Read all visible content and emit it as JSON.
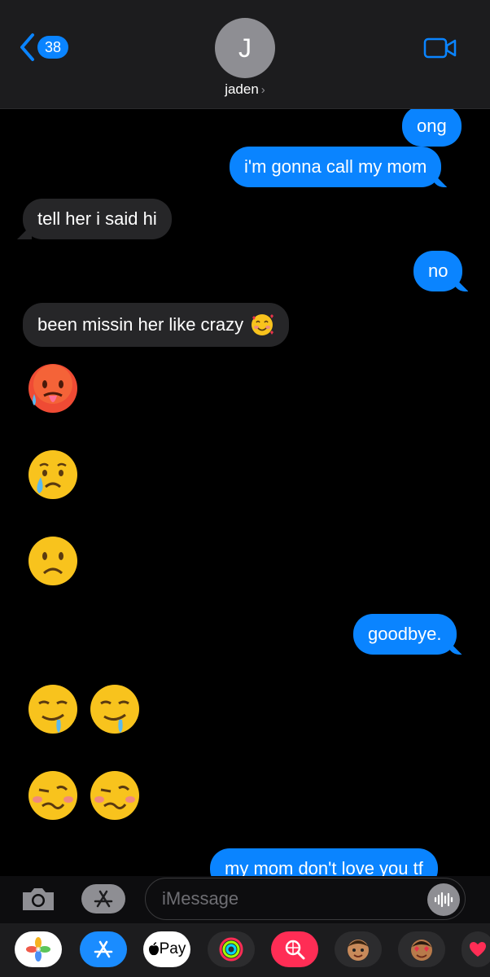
{
  "header": {
    "back_badge": "38",
    "avatar_initial": "J",
    "contact_name": "jaden",
    "contact_chevron": "›"
  },
  "messages": [
    {
      "side": "sent",
      "text": "ong"
    },
    {
      "side": "sent",
      "text": "i'm gonna call my mom"
    },
    {
      "side": "received",
      "text": "tell her i said hi"
    },
    {
      "side": "sent",
      "text": "no"
    },
    {
      "side": "received",
      "text": "been missin her like crazy",
      "emoji": "smiling-face-with-hearts"
    },
    {
      "side": "received",
      "emoji": "hot-face"
    },
    {
      "side": "received",
      "emoji": "crying-face"
    },
    {
      "side": "received",
      "emoji": "frowning-face"
    },
    {
      "side": "sent",
      "text": "goodbye."
    },
    {
      "side": "received",
      "emoji": "drooling-face",
      "count": 2
    },
    {
      "side": "received",
      "emoji": "woozy-face",
      "count": 2
    },
    {
      "side": "sent",
      "text": "my mom don't love you tf"
    }
  ],
  "input": {
    "placeholder": "iMessage"
  },
  "app_strip": {
    "pay_label": "Pay",
    "apps": [
      "photos-icon",
      "app-store-icon",
      "apple-pay-icon",
      "activity-icon",
      "image-search-icon",
      "memoji-icon",
      "memoji-stickers-icon",
      "digital-touch-icon"
    ]
  },
  "colors": {
    "sent_bubble": "#0a84ff",
    "received_bubble": "#262628",
    "background": "#000000",
    "header": "#1c1c1e"
  }
}
